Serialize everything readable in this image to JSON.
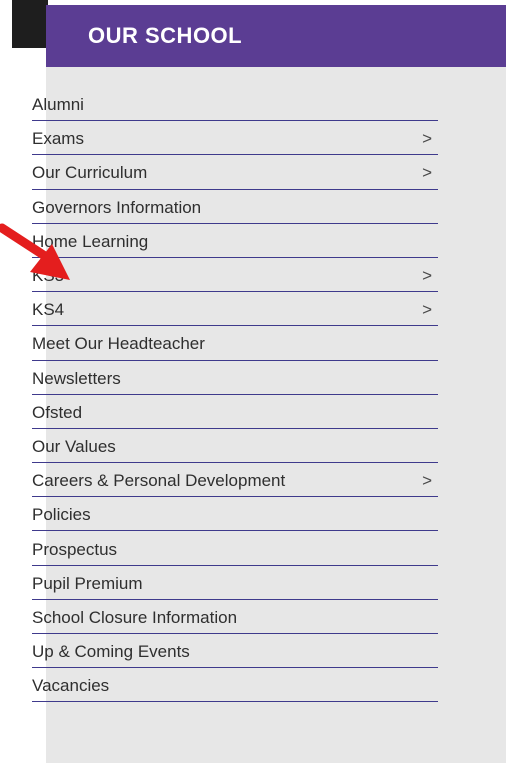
{
  "panel": {
    "title": "OUR SCHOOL"
  },
  "colors": {
    "header": "#5b3d93",
    "panel_bg": "#e7e7e7",
    "divider": "#3f3a8c",
    "arrow": "#e41e1e"
  },
  "menu": {
    "items": [
      {
        "label": "Alumni",
        "has_submenu": false
      },
      {
        "label": "Exams",
        "has_submenu": true
      },
      {
        "label": "Our Curriculum",
        "has_submenu": true
      },
      {
        "label": "Governors Information",
        "has_submenu": false
      },
      {
        "label": "Home Learning",
        "has_submenu": false
      },
      {
        "label": "KS3",
        "has_submenu": true
      },
      {
        "label": "KS4",
        "has_submenu": true
      },
      {
        "label": "Meet Our Headteacher",
        "has_submenu": false
      },
      {
        "label": "Newsletters",
        "has_submenu": false
      },
      {
        "label": "Ofsted",
        "has_submenu": false
      },
      {
        "label": "Our Values",
        "has_submenu": false
      },
      {
        "label": "Careers & Personal Development",
        "has_submenu": true
      },
      {
        "label": "Policies",
        "has_submenu": false
      },
      {
        "label": "Prospectus",
        "has_submenu": false
      },
      {
        "label": "Pupil Premium",
        "has_submenu": false
      },
      {
        "label": "School Closure Information",
        "has_submenu": false
      },
      {
        "label": "Up & Coming Events",
        "has_submenu": false
      },
      {
        "label": "Vacancies",
        "has_submenu": false
      }
    ],
    "chevron_glyph": ">"
  }
}
